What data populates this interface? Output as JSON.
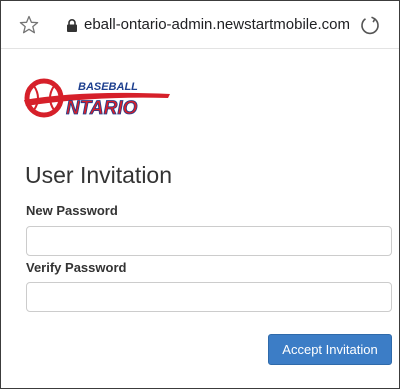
{
  "browser": {
    "url": "eball-ontario-admin.newstartmobile.com",
    "icons": [
      "star-icon",
      "lock-icon",
      "reload-icon"
    ]
  },
  "logo": {
    "line1": "BASEBALL",
    "line2": "NTARIO",
    "colors": {
      "red": "#d6202a",
      "blue": "#1d3f8f"
    }
  },
  "form": {
    "title": "User Invitation",
    "new_password_label": "New Password",
    "new_password_value": "",
    "verify_password_label": "Verify Password",
    "verify_password_value": "",
    "submit_label": "Accept Invitation"
  },
  "colors": {
    "accent": "#3c7dc6",
    "text": "#333333",
    "border": "#cccccc"
  }
}
